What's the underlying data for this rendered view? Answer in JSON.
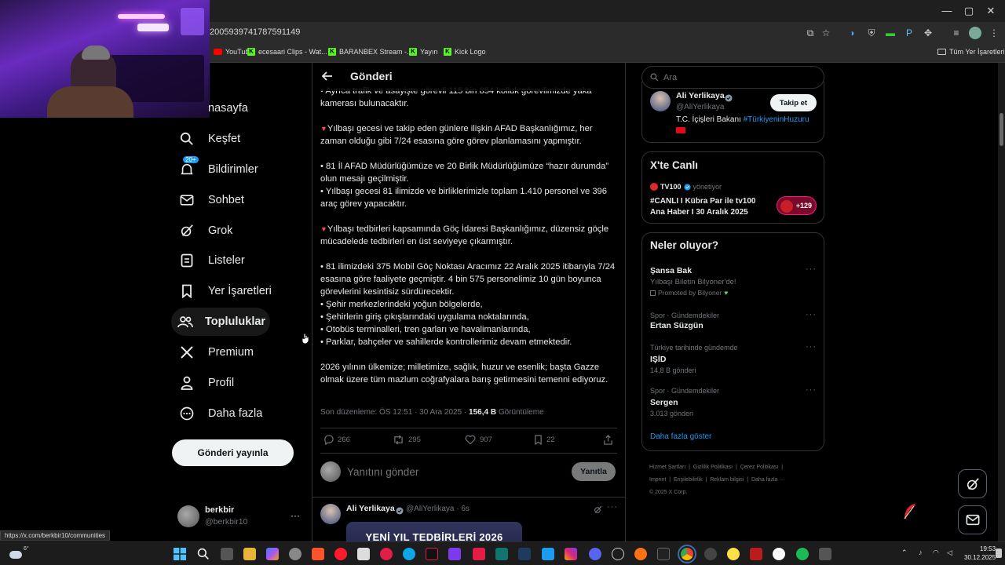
{
  "browser": {
    "url": "2005939741787591149",
    "bookmarks": [
      "YouTube",
      "ecesaari Clips - Wat...",
      "BARANBEX Stream -...",
      "Yayın",
      "Kick Logo"
    ],
    "all_bookmarks": "Tüm Yer İşaretleri",
    "status_url": "https://x.com/berkbir10/communities"
  },
  "sidebar": {
    "items": [
      {
        "label": "nasayfa",
        "icon": "home-icon"
      },
      {
        "label": "Keşfet",
        "icon": "search-icon"
      },
      {
        "label": "Bildirimler",
        "icon": "bell-icon",
        "badge": "20+"
      },
      {
        "label": "Sohbet",
        "icon": "envelope-icon"
      },
      {
        "label": "Grok",
        "icon": "grok-icon"
      },
      {
        "label": "Listeler",
        "icon": "list-icon"
      },
      {
        "label": "Yer İşaretleri",
        "icon": "bookmark-icon"
      },
      {
        "label": "Topluluklar",
        "icon": "communities-icon"
      },
      {
        "label": "Premium",
        "icon": "x-logo-icon"
      },
      {
        "label": "Profil",
        "icon": "person-icon"
      },
      {
        "label": "Daha fazla",
        "icon": "more-circle-icon"
      }
    ],
    "post_button": "Gönderi yayınla",
    "profile": {
      "name": "berkbir",
      "handle": "@berkbir10",
      "more": "···"
    }
  },
  "post": {
    "header_title": "Gönderi",
    "paragraphs": [
      "•  Ayrıca trafik ve asayişte görevli 115 bin 854 kolluk görevlimizde yaka kamerası bulunacaktır.",
      "Yılbaşı gecesi ve takip eden günlere ilişkin AFAD Başkanlığımız, her zaman olduğu gibi 7/24 esasına göre görev planlamasını yapmıştır.",
      "• 81 İl AFAD Müdürlüğümüze ve 20 Birlik Müdürlüğümüze “hazır durumda” olun mesajı geçilmiştir.\n• Yılbaşı gecesi 81 ilimizde ve birliklerimizle toplam 1.410 personel ve 396 araç görev yapacaktır.",
      "Yılbaşı tedbirleri kapsamında Göç İdaresi Başkanlığımız, düzensiz göçle mücadelede tedbirleri en üst seviyeye çıkarmıştır.",
      "• 81 ilimizdeki 375 Mobil Göç Noktası Aracımız 22 Aralık 2025 itibarıyla 7/24 esasına göre faaliyete geçmiştir. 4 bin 575 personelimiz 10 gün boyunca görevlerini kesintisiz sürdürecektir.\n• Şehir merkezlerindeki yoğun bölgelerde,\n• Şehirlerin giriş çıkışlarındaki uygulama noktalarında,\n• Otobüs terminalleri, tren garları ve havalimanlarında,\n• Parklar, bahçeler ve sahillerde kontrollerimiz devam etmektedir.",
      "2026 yılının ülkemize; milletimize, sağlık, huzur ve esenlik; başta Gazze olmak üzere tüm mazlum coğrafyalara barış getirmesini temenni ediyoruz."
    ],
    "meta_prefix": "Son düzenleme: ÖS 12:51 · 30 Ara 2025 · ",
    "views": "156,4 B",
    "views_label": " Görüntüleme",
    "replies": "266",
    "reposts": "295",
    "likes": "907",
    "bookmarks": "22",
    "reply_placeholder": "Yanıtını gönder",
    "reply_button": "Yanıtla",
    "next_author": "Ali Yerlikaya",
    "next_handle": "@AliYerlikaya · 6s",
    "next_image_text": "YENİ YIL TEDBİRLERİ 2026"
  },
  "right": {
    "search_placeholder": "Ara",
    "author": {
      "name": "Ali Yerlikaya",
      "handle": "@AliYerlikaya",
      "follow": "Takip et",
      "bio_prefix": "T.C. İçişleri Bakanı ",
      "bio_hashtag": "#TürkiyeninHuzuru"
    },
    "live": {
      "title": "X'te Canlı",
      "channel": "TV100",
      "role": "yönetiyor",
      "headline": "#CANLI I Kübra Par ile tv100 Ana Haber I 30 Aralık 2025",
      "listeners": "+129"
    },
    "trends_title": "Neler oluyor?",
    "trends": [
      {
        "cat": "",
        "title": "Şansa Bak",
        "sub": "Yılbaşı Biletin Bilyoner'de!",
        "extra": "Promoted by Bilyoner"
      },
      {
        "cat": "Spor · Gündemdekiler",
        "title": "Ertan Süzgün",
        "sub": "",
        "extra": ""
      },
      {
        "cat": "Türkiye tarihinde gündemde",
        "title": "IŞİD",
        "sub": "14,8 B gönderi",
        "extra": ""
      },
      {
        "cat": "Spor · Gündemdekiler",
        "title": "Sergen",
        "sub": "3.013 gönderi",
        "extra": ""
      }
    ],
    "show_more": "Daha fazla göster",
    "footer_links": [
      "Hizmet Şartları",
      "Gizlilik Politikası",
      "Çerez Politikası",
      "Imprint",
      "Erişilebilirlik",
      "Reklam bilgisi",
      "Daha fazla ···"
    ],
    "copyright": "© 2025 X Corp."
  },
  "taskbar": {
    "weather_temp": "6°",
    "time": "19:53",
    "date": "30.12.2025"
  },
  "colors": {
    "accent": "#1d9bf0",
    "bg": "#000000",
    "border": "#2f3336",
    "muted": "#71767b"
  }
}
